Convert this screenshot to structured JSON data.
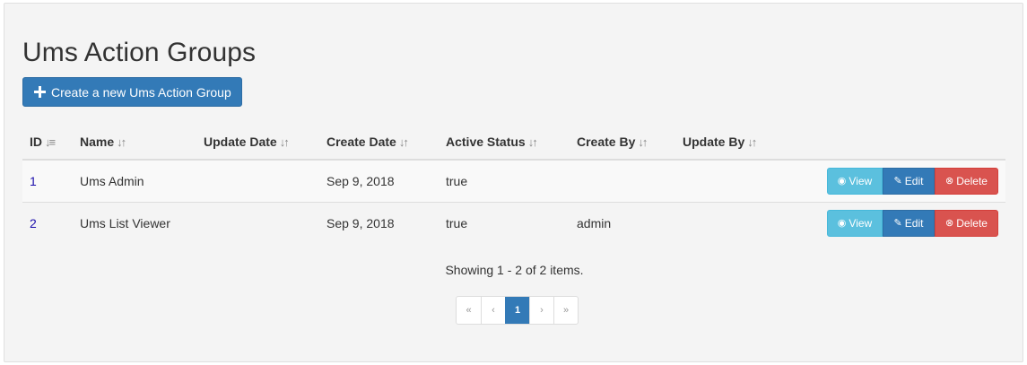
{
  "page": {
    "title": "Ums Action Groups",
    "create_button": "Create a new Ums Action Group"
  },
  "table": {
    "columns": [
      "ID",
      "Name",
      "Update Date",
      "Create Date",
      "Active Status",
      "Create By",
      "Update By"
    ],
    "rows": [
      {
        "id": "1",
        "name": "Ums Admin",
        "update_date": "",
        "create_date": "Sep 9, 2018",
        "active_status": "true",
        "create_by": "",
        "update_by": ""
      },
      {
        "id": "2",
        "name": "Ums List Viewer",
        "update_date": "",
        "create_date": "Sep 9, 2018",
        "active_status": "true",
        "create_by": "admin",
        "update_by": ""
      }
    ],
    "actions": {
      "view": "View",
      "edit": "Edit",
      "delete": "Delete"
    }
  },
  "summary": "Showing 1 - 2 of 2 items.",
  "pagination": {
    "first": "«",
    "prev": "‹",
    "current": "1",
    "next": "›",
    "last": "»"
  },
  "icons": {
    "create": "plus-icon",
    "view": "eye-icon",
    "edit": "pencil-icon",
    "delete": "times-circle-icon",
    "sort": "sort-icon"
  },
  "colors": {
    "primary": "#337ab7",
    "info": "#5bc0de",
    "danger": "#d9534f",
    "link": "#1a0dab"
  }
}
